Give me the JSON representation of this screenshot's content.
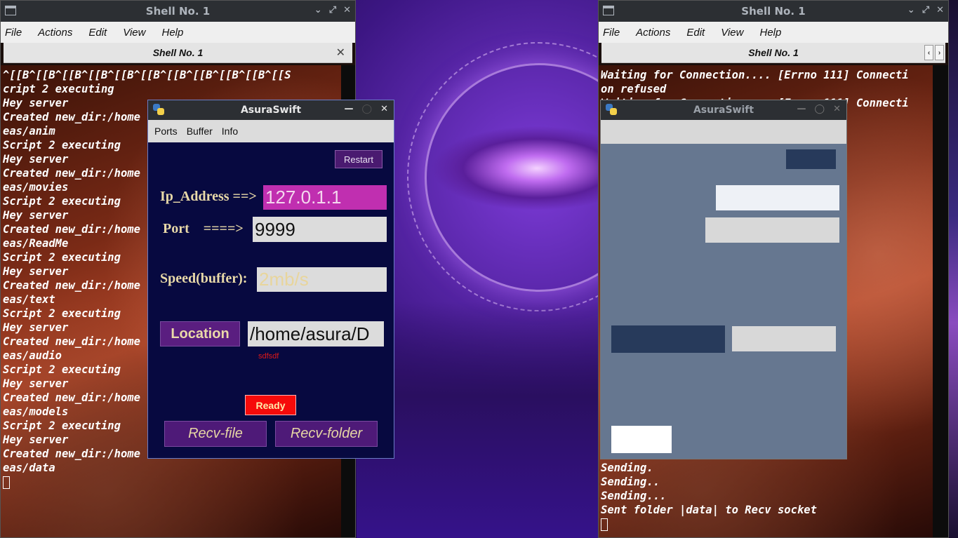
{
  "left_terminal": {
    "title": "Shell No. 1",
    "menu": [
      "File",
      "Actions",
      "Edit",
      "View",
      "Help"
    ],
    "tab": "Shell No. 1",
    "lines": [
      "^[[B^[[B^[[B^[[B^[[B^[[B^[[B^[[B^[[B^[[B^[[S",
      "cript 2 executing",
      "Hey server",
      "Created new_dir:/home",
      "eas/anim",
      "Script 2 executing",
      "Hey server",
      "Created new_dir:/home",
      "eas/movies",
      "Script 2 executing",
      "Hey server",
      "Created new_dir:/home",
      "eas/ReadMe",
      "Script 2 executing",
      "Hey server",
      "Created new_dir:/home",
      "eas/text",
      "Script 2 executing",
      "Hey server",
      "Created new_dir:/home",
      "eas/audio",
      "Script 2 executing",
      "Hey server",
      "Created new_dir:/home",
      "eas/models",
      "Script 2 executing",
      "Hey server",
      "Created new_dir:/home",
      "eas/data"
    ]
  },
  "right_terminal": {
    "title": "Shell No. 1",
    "menu": [
      "File",
      "Actions",
      "Edit",
      "View",
      "Help"
    ],
    "tab": "Shell No. 1",
    "top_lines": [
      "Waiting for Connection.... [Errno 111] Connecti",
      "on refused",
      "Waiting for Connection.... [Errno 111] Connecti"
    ],
    "bottom_lines": [
      "Sending.",
      "Sending..",
      "Sending...",
      "Sent folder |data| to Recv socket"
    ]
  },
  "app_left": {
    "title": "AsuraSwift",
    "menu": [
      "Ports",
      "Buffer",
      "Info"
    ],
    "restart_label": "Restart",
    "ip_label": "Ip_Address ==>",
    "ip_value": "127.0.1.1",
    "port_label": "Port    ====>",
    "port_value": "9999",
    "speed_label": "Speed(buffer):",
    "speed_placeholder": "2mb/s",
    "location_label": "Location",
    "location_value": "/home/asura/D",
    "error_text": "sdfsdf",
    "status": "Ready",
    "recv_file_label": "Recv-file",
    "recv_folder_label": "Recv-folder"
  },
  "app_right": {
    "title": "AsuraSwift"
  }
}
